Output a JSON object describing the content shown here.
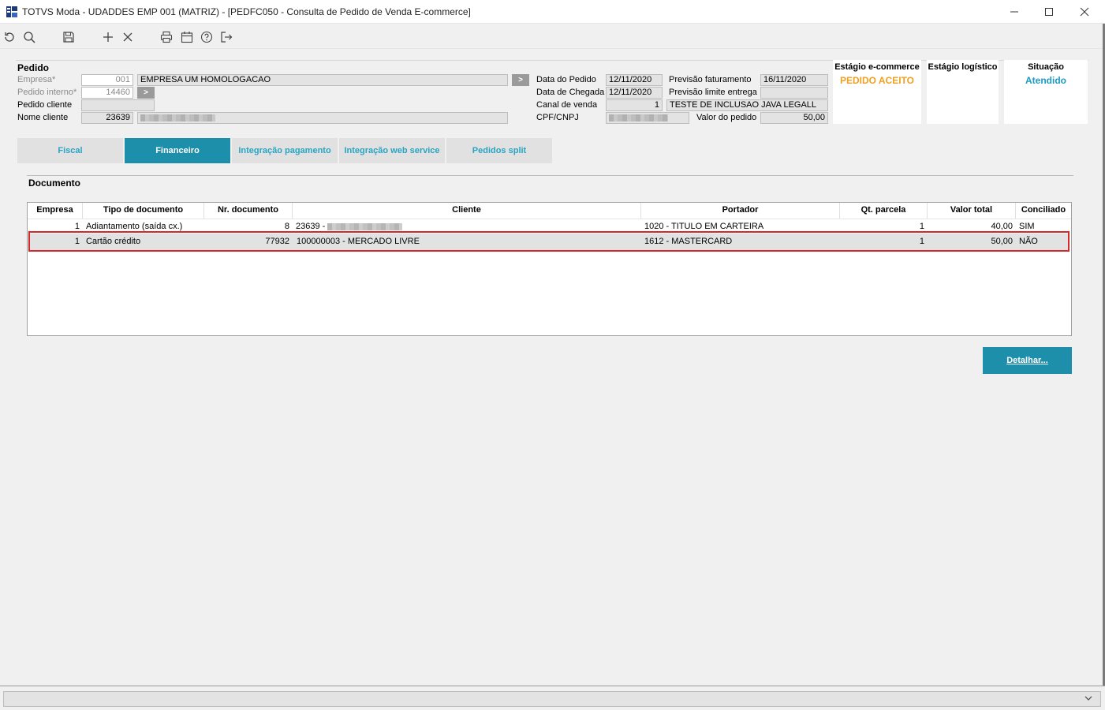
{
  "window": {
    "title": "TOTVS Moda - UDADDES EMP 001 (MATRIZ) - [PEDFC050 - Consulta de Pedido de Venda E-commerce]",
    "app_icon": "totvs-icon",
    "controls": [
      "minimize-icon",
      "maximize-icon",
      "close-icon"
    ]
  },
  "toolbar": {
    "icons": [
      "undo-icon",
      "search-icon",
      "save-icon",
      "add-icon",
      "close-icon",
      "print-icon",
      "calendar-icon",
      "help-icon",
      "exit-icon"
    ]
  },
  "pedido": {
    "section_title": "Pedido",
    "empresa_label": "Empresa*",
    "empresa_value": "001",
    "empresa_name": "EMPRESA UM HOMOLOGACAO",
    "pedido_interno_label": "Pedido interno*",
    "pedido_interno_value": "14460",
    "pedido_cliente_label": "Pedido cliente",
    "pedido_cliente_value": "",
    "nome_cliente_label": "Nome cliente",
    "nome_cliente_code": "23639",
    "data_pedido_label": "Data do Pedido",
    "data_pedido_value": "12/11/2020",
    "data_chegada_label": "Data de Chegada",
    "data_chegada_value": "12/11/2020",
    "canal_venda_label": "Canal de venda",
    "canal_venda_code": "1",
    "canal_venda_name": "TESTE DE INCLUSAO JAVA LEGALL",
    "cpf_label": "CPF/CNPJ",
    "previsao_fat_label": "Previsão faturamento",
    "previsao_fat_value": "16/11/2020",
    "previsao_limite_label": "Previsão limite entrega",
    "previsao_limite_value": "",
    "valor_pedido_label": "Valor do pedido",
    "valor_pedido_value": "50,00"
  },
  "stages": {
    "ecommerce_title": "Estágio e-commerce",
    "ecommerce_value": "PEDIDO ACEITO",
    "ecommerce_color": "#f0a020",
    "logistico_title": "Estágio logístico",
    "logistico_value": "",
    "situacao_title": "Situação",
    "situacao_value": "Atendido",
    "situacao_color": "#1d9ac0"
  },
  "tabs": [
    {
      "label": "Fiscal",
      "active": false
    },
    {
      "label": "Financeiro",
      "active": true
    },
    {
      "label": "Integração pagamento",
      "active": false
    },
    {
      "label": "Integração web service",
      "active": false
    },
    {
      "label": "Pedidos split",
      "active": false
    }
  ],
  "documento": {
    "title": "Documento",
    "columns": [
      "Empresa",
      "Tipo de documento",
      "Nr. documento",
      "Cliente",
      "Portador",
      "Qt. parcela",
      "Valor total",
      "Conciliado"
    ],
    "rows": [
      {
        "empresa": "1",
        "tipo": "Adiantamento (saída cx.)",
        "nr": "8",
        "cliente": "23639 -",
        "portador": "1020 - TITULO EM CARTEIRA",
        "qt": "1",
        "valor": "40,00",
        "conciliado": "SIM"
      },
      {
        "empresa": "1",
        "tipo": "Cartão crédito",
        "nr": "77932",
        "cliente": "100000003 - MERCADO LIVRE",
        "portador": "1612 - MASTERCARD",
        "qt": "1",
        "valor": "50,00",
        "conciliado": "NÃO"
      }
    ]
  },
  "detalhar_label": "Detalhar...",
  "colors": {
    "accent": "#1d8fab",
    "tab_text": "#2aa4c2",
    "highlight_border": "#d62828"
  }
}
